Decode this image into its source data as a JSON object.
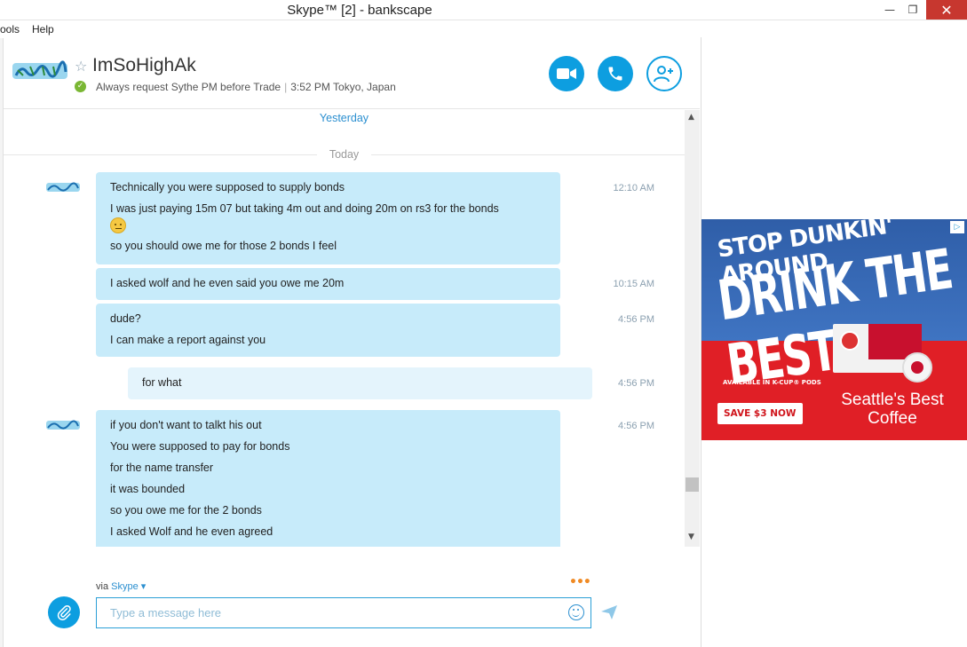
{
  "window": {
    "title": "Skype™ [2] - bankscape",
    "minimize": "—",
    "maximize": "❐",
    "close": "✕"
  },
  "menu": [
    "ools",
    "Help"
  ],
  "header": {
    "contact_name": "ImSoHighAk",
    "status_message": "Always request Sythe PM before Trade",
    "local_time": "3:52 PM Tokyo, Japan",
    "separator": "|",
    "status": "online"
  },
  "chat": {
    "yesterday_label": "Yesterday",
    "today_label": "Today",
    "messages": [
      {
        "sender": "contact",
        "lines": [
          "Technically you were supposed to supply bonds",
          "I was just paying 15m 07 but taking 4m out and doing 20m on rs3 for the bonds",
          "so you should owe me for those 2 bonds I feel"
        ],
        "time": "12:10 AM"
      },
      {
        "sender": "contact",
        "lines": [
          "I asked wolf and he even said you owe me 20m"
        ],
        "time": "10:15 AM"
      },
      {
        "sender": "contact",
        "lines": [
          "dude?",
          "I can make a report against you"
        ],
        "time": "4:56 PM"
      },
      {
        "sender": "me",
        "lines": [
          "for what"
        ],
        "time": "4:56 PM"
      },
      {
        "sender": "contact",
        "lines": [
          "if you don't want to talkt his out",
          "You were supposed to pay for bonds",
          "for the name transfer",
          "it was bounded",
          "so you owe me for the 2 bonds",
          "I asked Wolf and he even agreed"
        ],
        "time": "4:56 PM"
      }
    ]
  },
  "compose": {
    "via_prefix": "via",
    "via_service": "Skype",
    "placeholder": "Type a message here",
    "typing_indicator": "•••"
  },
  "ad": {
    "headline_1": "STOP DUNKIN' AROUND",
    "headline_2": "DRINK THE BEST",
    "availability": "AVAILABLE IN K-CUP® PODS",
    "cta": "SAVE $3 NOW",
    "brand_line_1": "Seattle's Best",
    "brand_line_2": "Coffee",
    "adchoices": "▷"
  },
  "colors": {
    "accent": "#0d9ee0",
    "bubble_contact": "#c7ebfa",
    "bubble_me": "#e4f4fc",
    "online": "#7ab734",
    "ad_blue": "#2f5ea8",
    "ad_red": "#e01f26"
  },
  "icons": [
    "star-icon",
    "video-call-icon",
    "phone-call-icon",
    "add-contact-icon",
    "attach-icon",
    "emoticon-icon",
    "send-icon"
  ]
}
